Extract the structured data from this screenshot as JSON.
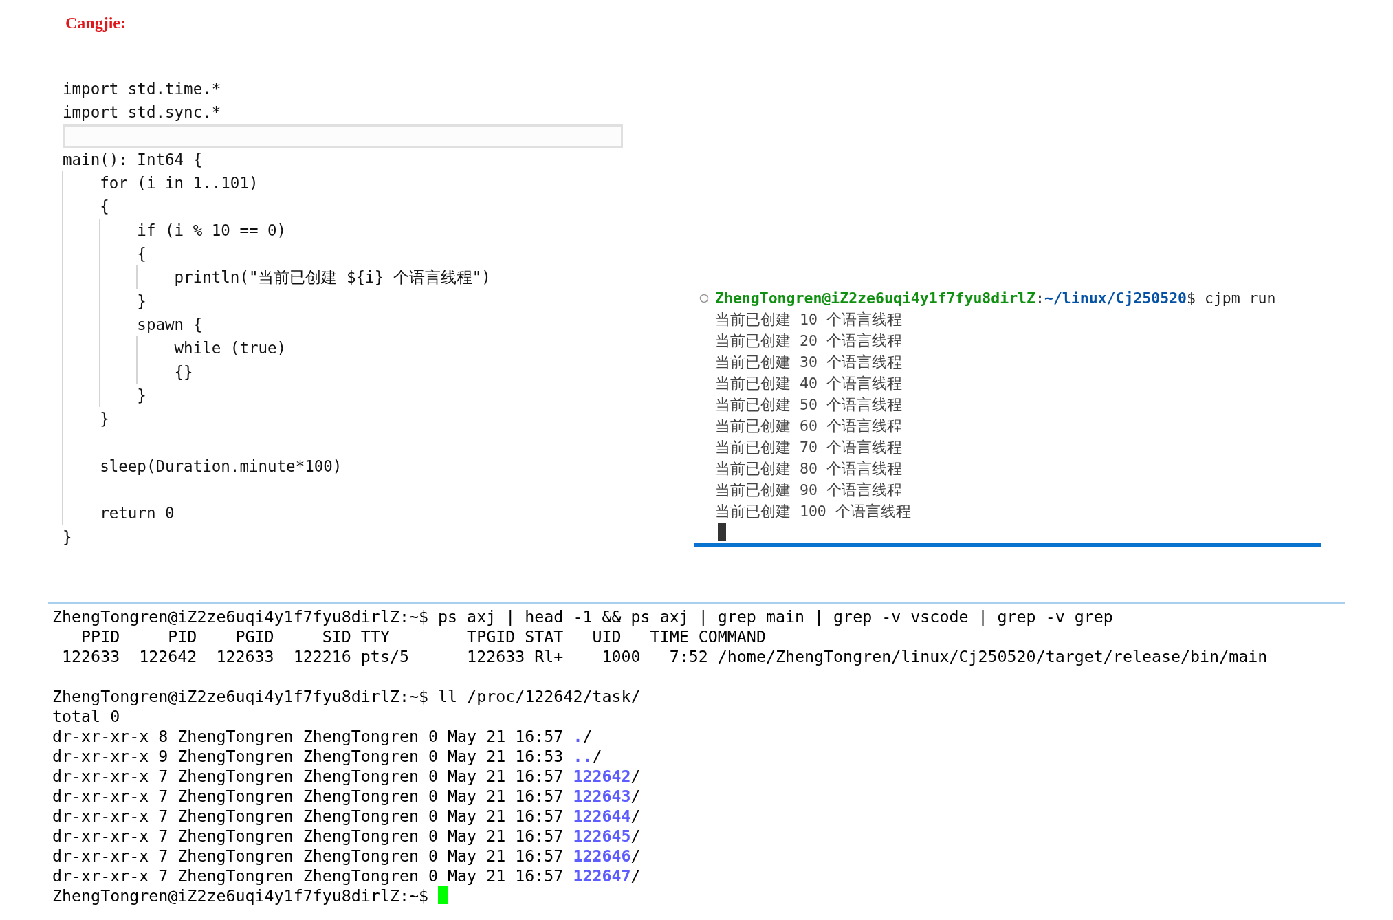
{
  "title": "Cangjie:",
  "code": {
    "lines": [
      {
        "text": "import std.time.*",
        "highlighted": false
      },
      {
        "text": "import std.sync.*",
        "highlighted": false
      },
      {
        "highlighted": true
      },
      {
        "text": "main(): Int64 {",
        "highlighted": false
      },
      {
        "text": "    for (i in 1..101)",
        "highlighted": false
      },
      {
        "text": "    {",
        "highlighted": false
      },
      {
        "text": "        if (i % 10 == 0)",
        "highlighted": false
      },
      {
        "text": "        {",
        "highlighted": false
      },
      {
        "text": "            println(\"当前已创建 ${i} 个语言线程\")",
        "highlighted": false
      },
      {
        "text": "        }",
        "highlighted": false
      },
      {
        "text": "        spawn {",
        "highlighted": false
      },
      {
        "text": "            while (true)",
        "highlighted": false
      },
      {
        "text": "            {}",
        "highlighted": false
      },
      {
        "text": "        }",
        "highlighted": false
      },
      {
        "text": "    }",
        "highlighted": false
      },
      {
        "highlighted": false
      },
      {
        "text": "    sleep(Duration.minute*100)",
        "highlighted": false
      },
      {
        "highlighted": false
      },
      {
        "text": "    return 0",
        "highlighted": false
      },
      {
        "text": "}",
        "highlighted": false
      }
    ]
  },
  "run_terminal": {
    "prompt": {
      "user_host": "ZhengTongren@iZ2ze6uqi4y1f7fyu8dirlZ",
      "separator": ":",
      "path": "~/linux/Cj250520",
      "command": "$ cjpm run"
    },
    "output": [
      "当前已创建 10 个语言线程",
      "当前已创建 20 个语言线程",
      "当前已创建 30 个语言线程",
      "当前已创建 40 个语言线程",
      "当前已创建 50 个语言线程",
      "当前已创建 60 个语言线程",
      "当前已创建 70 个语言线程",
      "当前已创建 80 个语言线程",
      "当前已创建 90 个语言线程",
      "当前已创建 100 个语言线程"
    ]
  },
  "shell": {
    "lines": [
      {
        "kind": "text",
        "text": "ZhengTongren@iZ2ze6uqi4y1f7fyu8dirlZ:~$ ps axj | head -1 && ps axj | grep main | grep -v vscode | grep -v grep"
      },
      {
        "kind": "text",
        "text": "   PPID     PID    PGID     SID TTY        TPGID STAT   UID   TIME COMMAND"
      },
      {
        "kind": "text",
        "text": " 122633  122642  122633  122216 pts/5      122633 Rl+    1000   7:52 /home/ZhengTongren/linux/Cj250520/target/release/bin/main"
      },
      {
        "kind": "blank"
      },
      {
        "kind": "text",
        "text": "ZhengTongren@iZ2ze6uqi4y1f7fyu8dirlZ:~$ ll /proc/122642/task/"
      },
      {
        "kind": "text",
        "text": "total 0"
      },
      {
        "kind": "entry",
        "text": "dr-xr-xr-x 8 ZhengTongren ZhengTongren 0 May 21 16:57 ",
        "name": ".",
        "suffix": "/"
      },
      {
        "kind": "entry",
        "text": "dr-xr-xr-x 9 ZhengTongren ZhengTongren 0 May 21 16:53 ",
        "name": "..",
        "suffix": "/"
      },
      {
        "kind": "entry",
        "text": "dr-xr-xr-x 7 ZhengTongren ZhengTongren 0 May 21 16:57 ",
        "name": "122642",
        "suffix": "/"
      },
      {
        "kind": "entry",
        "text": "dr-xr-xr-x 7 ZhengTongren ZhengTongren 0 May 21 16:57 ",
        "name": "122643",
        "suffix": "/"
      },
      {
        "kind": "entry",
        "text": "dr-xr-xr-x 7 ZhengTongren ZhengTongren 0 May 21 16:57 ",
        "name": "122644",
        "suffix": "/"
      },
      {
        "kind": "entry",
        "text": "dr-xr-xr-x 7 ZhengTongren ZhengTongren 0 May 21 16:57 ",
        "name": "122645",
        "suffix": "/"
      },
      {
        "kind": "entry",
        "text": "dr-xr-xr-x 7 ZhengTongren ZhengTongren 0 May 21 16:57 ",
        "name": "122646",
        "suffix": "/"
      },
      {
        "kind": "entry",
        "text": "dr-xr-xr-x 7 ZhengTongren ZhengTongren 0 May 21 16:57 ",
        "name": "122647",
        "suffix": "/"
      },
      {
        "kind": "prompt",
        "text": "ZhengTongren@iZ2ze6uqi4y1f7fyu8dirlZ:~$ "
      }
    ]
  }
}
